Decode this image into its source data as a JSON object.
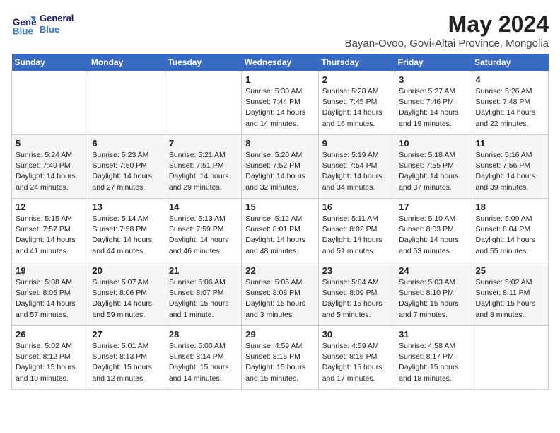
{
  "header": {
    "logo_line1": "General",
    "logo_line2": "Blue",
    "title": "May 2024",
    "subtitle": "Bayan-Ovoo, Govi-Altai Province, Mongolia"
  },
  "days_of_week": [
    "Sunday",
    "Monday",
    "Tuesday",
    "Wednesday",
    "Thursday",
    "Friday",
    "Saturday"
  ],
  "weeks": [
    [
      {
        "day": "",
        "info": ""
      },
      {
        "day": "",
        "info": ""
      },
      {
        "day": "",
        "info": ""
      },
      {
        "day": "1",
        "info": "Sunrise: 5:30 AM\nSunset: 7:44 PM\nDaylight: 14 hours\nand 14 minutes."
      },
      {
        "day": "2",
        "info": "Sunrise: 5:28 AM\nSunset: 7:45 PM\nDaylight: 14 hours\nand 16 minutes."
      },
      {
        "day": "3",
        "info": "Sunrise: 5:27 AM\nSunset: 7:46 PM\nDaylight: 14 hours\nand 19 minutes."
      },
      {
        "day": "4",
        "info": "Sunrise: 5:26 AM\nSunset: 7:48 PM\nDaylight: 14 hours\nand 22 minutes."
      }
    ],
    [
      {
        "day": "5",
        "info": "Sunrise: 5:24 AM\nSunset: 7:49 PM\nDaylight: 14 hours\nand 24 minutes."
      },
      {
        "day": "6",
        "info": "Sunrise: 5:23 AM\nSunset: 7:50 PM\nDaylight: 14 hours\nand 27 minutes."
      },
      {
        "day": "7",
        "info": "Sunrise: 5:21 AM\nSunset: 7:51 PM\nDaylight: 14 hours\nand 29 minutes."
      },
      {
        "day": "8",
        "info": "Sunrise: 5:20 AM\nSunset: 7:52 PM\nDaylight: 14 hours\nand 32 minutes."
      },
      {
        "day": "9",
        "info": "Sunrise: 5:19 AM\nSunset: 7:54 PM\nDaylight: 14 hours\nand 34 minutes."
      },
      {
        "day": "10",
        "info": "Sunrise: 5:18 AM\nSunset: 7:55 PM\nDaylight: 14 hours\nand 37 minutes."
      },
      {
        "day": "11",
        "info": "Sunrise: 5:16 AM\nSunset: 7:56 PM\nDaylight: 14 hours\nand 39 minutes."
      }
    ],
    [
      {
        "day": "12",
        "info": "Sunrise: 5:15 AM\nSunset: 7:57 PM\nDaylight: 14 hours\nand 41 minutes."
      },
      {
        "day": "13",
        "info": "Sunrise: 5:14 AM\nSunset: 7:58 PM\nDaylight: 14 hours\nand 44 minutes."
      },
      {
        "day": "14",
        "info": "Sunrise: 5:13 AM\nSunset: 7:59 PM\nDaylight: 14 hours\nand 46 minutes."
      },
      {
        "day": "15",
        "info": "Sunrise: 5:12 AM\nSunset: 8:01 PM\nDaylight: 14 hours\nand 48 minutes."
      },
      {
        "day": "16",
        "info": "Sunrise: 5:11 AM\nSunset: 8:02 PM\nDaylight: 14 hours\nand 51 minutes."
      },
      {
        "day": "17",
        "info": "Sunrise: 5:10 AM\nSunset: 8:03 PM\nDaylight: 14 hours\nand 53 minutes."
      },
      {
        "day": "18",
        "info": "Sunrise: 5:09 AM\nSunset: 8:04 PM\nDaylight: 14 hours\nand 55 minutes."
      }
    ],
    [
      {
        "day": "19",
        "info": "Sunrise: 5:08 AM\nSunset: 8:05 PM\nDaylight: 14 hours\nand 57 minutes."
      },
      {
        "day": "20",
        "info": "Sunrise: 5:07 AM\nSunset: 8:06 PM\nDaylight: 14 hours\nand 59 minutes."
      },
      {
        "day": "21",
        "info": "Sunrise: 5:06 AM\nSunset: 8:07 PM\nDaylight: 15 hours\nand 1 minute."
      },
      {
        "day": "22",
        "info": "Sunrise: 5:05 AM\nSunset: 8:08 PM\nDaylight: 15 hours\nand 3 minutes."
      },
      {
        "day": "23",
        "info": "Sunrise: 5:04 AM\nSunset: 8:09 PM\nDaylight: 15 hours\nand 5 minutes."
      },
      {
        "day": "24",
        "info": "Sunrise: 5:03 AM\nSunset: 8:10 PM\nDaylight: 15 hours\nand 7 minutes."
      },
      {
        "day": "25",
        "info": "Sunrise: 5:02 AM\nSunset: 8:11 PM\nDaylight: 15 hours\nand 8 minutes."
      }
    ],
    [
      {
        "day": "26",
        "info": "Sunrise: 5:02 AM\nSunset: 8:12 PM\nDaylight: 15 hours\nand 10 minutes."
      },
      {
        "day": "27",
        "info": "Sunrise: 5:01 AM\nSunset: 8:13 PM\nDaylight: 15 hours\nand 12 minutes."
      },
      {
        "day": "28",
        "info": "Sunrise: 5:00 AM\nSunset: 8:14 PM\nDaylight: 15 hours\nand 14 minutes."
      },
      {
        "day": "29",
        "info": "Sunrise: 4:59 AM\nSunset: 8:15 PM\nDaylight: 15 hours\nand 15 minutes."
      },
      {
        "day": "30",
        "info": "Sunrise: 4:59 AM\nSunset: 8:16 PM\nDaylight: 15 hours\nand 17 minutes."
      },
      {
        "day": "31",
        "info": "Sunrise: 4:58 AM\nSunset: 8:17 PM\nDaylight: 15 hours\nand 18 minutes."
      },
      {
        "day": "",
        "info": ""
      }
    ]
  ]
}
